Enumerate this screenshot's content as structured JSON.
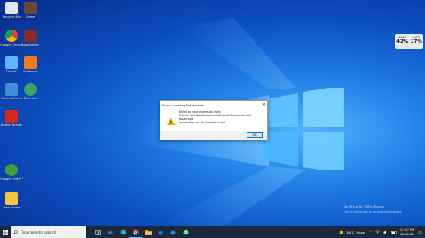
{
  "desktop": {
    "icons": [
      {
        "label": "Recycle Bin",
        "color": "#dfe6ee"
      },
      {
        "label": "Google Chrome",
        "color": "#e8e8e8"
      },
      {
        "label": "This PC",
        "color": "#5fb6ff"
      },
      {
        "label": "Control Panel",
        "color": "#3a8fd8"
      },
      {
        "label": "Adobe Reader",
        "color": "#d9261c"
      },
      {
        "label": "Google Earth Pro",
        "color": "#3e9c3a"
      },
      {
        "label": "New folder",
        "color": "#f4c542"
      },
      {
        "label": "Game",
        "color": "#6b4a2f"
      },
      {
        "label": "Application",
        "color": "#8a2b2b"
      },
      {
        "label": "Software",
        "color": "#f07b1c"
      },
      {
        "label": "Network",
        "color": "#38a46a"
      }
    ]
  },
  "widget": {
    "left_label": "MSN",
    "left_value": "42%",
    "right_label": "USD",
    "right_value": "17%"
  },
  "dialog": {
    "title": "Error Loading Extensions",
    "message_line1": "Failed to load extension from:",
    "message_line2": "C:\\Users\\hp\\AppData\\Local\\Default. Could not load javascript",
    "message_line3": "'src/content.js' for content script.",
    "ok_label": "OK",
    "close_glyph": "×"
  },
  "watermark": {
    "line1": "Activate Windows",
    "line2": "Go to Settings to activate Windows."
  },
  "taskbar": {
    "search_placeholder": "Type here to search",
    "apps": [
      "task-view",
      "file-explorer",
      "edge",
      "chrome",
      "mail",
      "store",
      "photos",
      "whatsapp"
    ],
    "weather_temp": "26°C",
    "weather_desc": "Haze",
    "time": "12:57 PM",
    "date": "8/1/2022",
    "accent": "#1a2a3c"
  }
}
